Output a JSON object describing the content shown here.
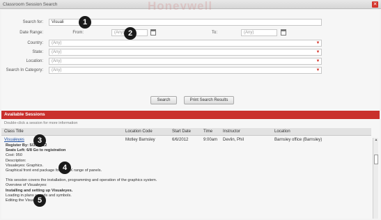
{
  "window": {
    "title": "Classroom Session Search",
    "watermark": "Honeywell",
    "close_icon": "close-icon"
  },
  "search": {
    "search_for_label": "Search for:",
    "search_for_value": "Visuali",
    "date_range_label": "Date Range:",
    "from_label": "From:",
    "from_value": "(Any)",
    "to_label": "To:",
    "to_value": "(Any)",
    "country_label": "Country:",
    "country_value": "(Any)",
    "state_label": "State:",
    "state_value": "(Any)",
    "location_label": "Location:",
    "location_value": "(Any)",
    "category_label": "Search In Category:",
    "category_value": "(Any)",
    "search_button": "Search",
    "print_button": "Print Search Results"
  },
  "results": {
    "title": "Available Sessions",
    "hint": "Double-click a session for more information",
    "columns": [
      "Class Title",
      "Location Code",
      "Start Date",
      "Time",
      "Instructor",
      "Location"
    ],
    "row": {
      "title": "Visualeyes",
      "location_code": "Motley Barnsley",
      "start_date": "6/6/2012",
      "time": "9:00am",
      "instructor": "Devlin, Phil",
      "location": "Barnsley office (Barnsley)"
    },
    "detail": {
      "register_by": "Register By: 5/31/2012",
      "seats": "Seats Left: 6/8 Go to registration",
      "cost": "Cost: 950",
      "description_label": "Description:",
      "desc_line1": "Visualeyes: Graphics.",
      "desc_line2": "Graphical front end package for the ZX range of panels.",
      "desc_line3": "This session covers the installation, programming and operation of the graphics system.",
      "overview": "Overview of Visualeyes:",
      "install": "Installing and setting up Visualeyes.",
      "loading": "Loading in plans sounds and symbols.",
      "editing": "Editing the Visualeyes"
    }
  },
  "callouts": [
    "1",
    "2",
    "3",
    "4",
    "5"
  ],
  "colors": {
    "accent": "#c9302c",
    "link": "#1f4fa0",
    "callout": "#1a1a1a"
  }
}
